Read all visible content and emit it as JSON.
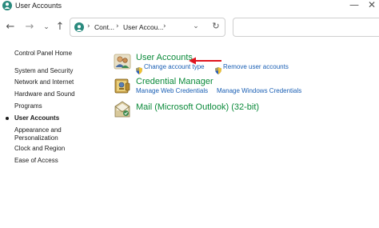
{
  "window": {
    "title": "User Accounts",
    "minimize_glyph": "—",
    "close_glyph": "✕"
  },
  "toolbar": {
    "back_glyph": "←",
    "forward_glyph": "→",
    "recent_glyph": "⌄",
    "up_glyph": "↑",
    "breadcrumb": [
      "Cont...",
      "User Accou..."
    ],
    "separator_glyph": "›",
    "dropdown_glyph": "⌄",
    "refresh_glyph": "↻"
  },
  "leftnav": {
    "items": [
      {
        "label": "Control Panel Home"
      },
      {
        "label": "System and Security"
      },
      {
        "label": "Network and Internet"
      },
      {
        "label": "Hardware and Sound"
      },
      {
        "label": "Programs"
      },
      {
        "label": "User Accounts",
        "active": true
      },
      {
        "label": "Appearance and Personalization"
      },
      {
        "label": "Clock and Region"
      },
      {
        "label": "Ease of Access"
      }
    ]
  },
  "main": {
    "groups": [
      {
        "title": "User Accounts",
        "icon": "users-icon",
        "tasks": [
          "Change account type",
          "Remove user accounts"
        ]
      },
      {
        "title": "Credential Manager",
        "icon": "credential-manager-icon",
        "tasks": [
          "Manage Web Credentials",
          "Manage Windows Credentials"
        ]
      },
      {
        "title": "Mail (Microsoft Outlook) (32-bit)",
        "icon": "mail-icon",
        "tasks": []
      }
    ]
  },
  "colors": {
    "group_title": "#0b8a3a",
    "task_link": "#1a5fb4",
    "annotation_arrow": "#e0141e",
    "app_icon": "#2a8a7e"
  }
}
